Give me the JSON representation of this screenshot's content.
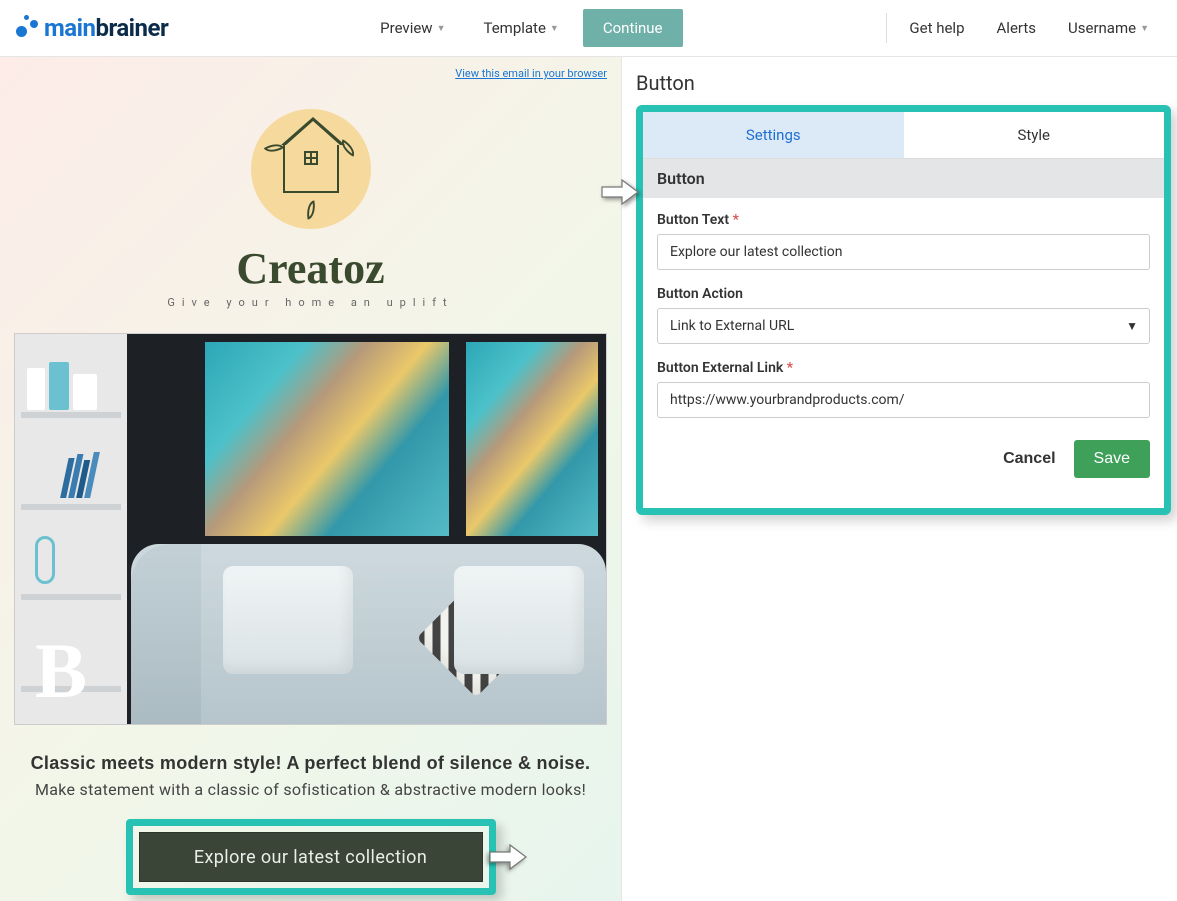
{
  "nav": {
    "logo_main": "main",
    "logo_brain": "brainer",
    "preview": "Preview",
    "template": "Template",
    "continue": "Continue",
    "get_help": "Get help",
    "alerts": "Alerts",
    "username": "Username"
  },
  "preview": {
    "view_browser": "View this email in your browser",
    "brand_name": "Creatoz",
    "brand_tagline": "Give your home an uplift",
    "headline": "Classic meets modern style! A perfect blend of silence & noise.",
    "subline": "Make statement with a classic of sofistication & abstractive modern looks!",
    "cta_label": "Explore our latest collection"
  },
  "panel": {
    "title": "Button",
    "tabs": {
      "settings": "Settings",
      "style": "Style"
    },
    "section": "Button",
    "button_text_label": "Button Text",
    "button_text_value": "Explore our latest collection",
    "button_action_label": "Button Action",
    "button_action_value": "Link to External URL",
    "external_link_label": "Button External Link",
    "external_link_value": "https://www.yourbrandproducts.com/",
    "cancel": "Cancel",
    "save": "Save"
  }
}
